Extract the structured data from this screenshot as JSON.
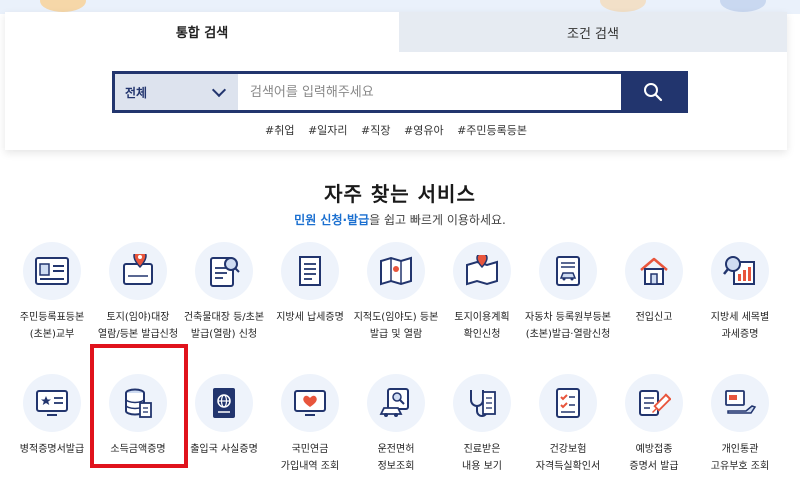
{
  "tabs": {
    "integrated": "통합 검색",
    "conditional": "조건 검색"
  },
  "search": {
    "scope": "전체",
    "placeholder": "검색어를 입력해주세요"
  },
  "tags": [
    "#취업",
    "#일자리",
    "#직장",
    "#영유아",
    "#주민등록등본"
  ],
  "services": {
    "title": "자주 찾는 서비스",
    "subtitle_highlight": "민원 신청·발급",
    "subtitle_rest": "을 쉽고 빠르게 이용하세요.",
    "row1": [
      {
        "icon": "resident-register-icon",
        "line1": "주민등록표등본",
        "line2": "(초본)교부"
      },
      {
        "icon": "land-map-icon",
        "line1": "토지(임야)대장",
        "line2": "열람/등본 발급신청"
      },
      {
        "icon": "building-register-icon",
        "line1": "건축물대장 등/초본",
        "line2": "발급(열람) 신청"
      },
      {
        "icon": "tax-payment-icon",
        "line1": "지방세 납세증명",
        "line2": ""
      },
      {
        "icon": "cadastral-map-icon",
        "line1": "지적도(임야도) 등본",
        "line2": "발급 및 열람"
      },
      {
        "icon": "land-use-plan-icon",
        "line1": "토지이용계획",
        "line2": "확인신청"
      },
      {
        "icon": "vehicle-register-icon",
        "line1": "자동차 등록원부등본",
        "line2": "(초본)발급·열람신청"
      },
      {
        "icon": "move-in-report-icon",
        "line1": "전입신고",
        "line2": ""
      },
      {
        "icon": "tax-item-certificate-icon",
        "line1": "지방세 세목별",
        "line2": "과세증명"
      }
    ],
    "row2": [
      {
        "icon": "military-service-icon",
        "line1": "병적증명서발급",
        "line2": ""
      },
      {
        "icon": "income-certificate-icon",
        "line1": "소득금액증명",
        "line2": ""
      },
      {
        "icon": "passport-icon",
        "line1": "출입국 사실증명",
        "line2": ""
      },
      {
        "icon": "pension-icon",
        "line1": "국민연금",
        "line2": "가입내역 조회"
      },
      {
        "icon": "driver-license-icon",
        "line1": "운전면허",
        "line2": "정보조회"
      },
      {
        "icon": "medical-record-icon",
        "line1": "진료받은",
        "line2": "내용 보기"
      },
      {
        "icon": "health-insurance-icon",
        "line1": "건강보험",
        "line2": "자격득실확인서"
      },
      {
        "icon": "vaccination-icon",
        "line1": "예방접종",
        "line2": "증명서 발급"
      },
      {
        "icon": "customs-icon",
        "line1": "개인통관",
        "line2": "고유부호 조회"
      }
    ]
  },
  "colors": {
    "navy": "#22356e",
    "accent_blue": "#1a6fd0",
    "highlight_red": "#e0121c"
  }
}
